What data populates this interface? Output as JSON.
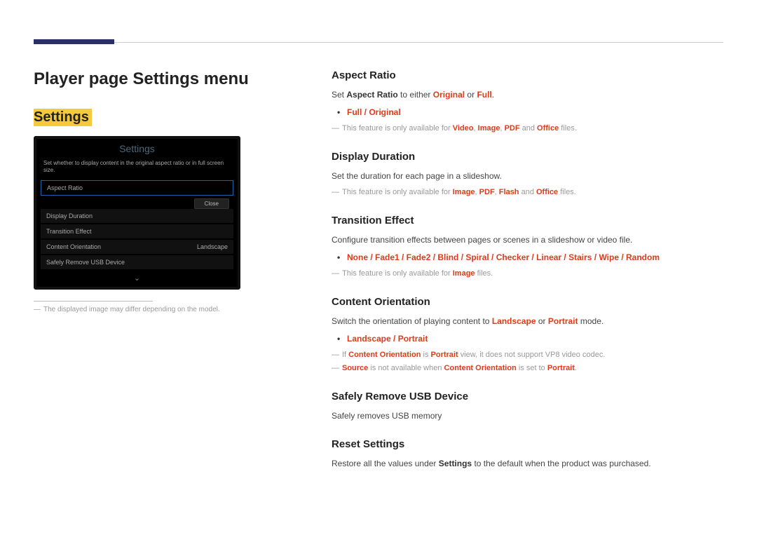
{
  "page_title": "Player page Settings menu",
  "left": {
    "highlight": "Settings",
    "img_note": "The displayed image may differ depending on the model."
  },
  "device": {
    "title": "Settings",
    "desc": "Set whether to display content in the original aspect ratio or in full screen size.",
    "rows": {
      "r0": "Aspect Ratio",
      "r1": "Display Duration",
      "r2": "Transition Effect",
      "r3": "Content Orientation",
      "r3v": "Landscape",
      "r4": "Safely Remove USB Device"
    },
    "close": "Close"
  },
  "aspect": {
    "head": "Aspect Ratio",
    "p1a": "Set ",
    "p1b": "Aspect Ratio",
    "p1c": " to either ",
    "p1d": "Original",
    "p1e": " or ",
    "p1f": "Full",
    "p1g": ".",
    "opt": "Full / Original",
    "note_a": "This feature is only available for ",
    "note_v": "Video",
    "note_i": "Image",
    "note_p": "PDF",
    "note_o": "Office",
    "note_z": " files.",
    "sep": ", ",
    "and": " and "
  },
  "duration": {
    "head": "Display Duration",
    "p1": "Set the duration for each page in a slideshow.",
    "note_a": "This feature is only available for ",
    "note_i": "Image",
    "note_p": "PDF",
    "note_f": "Flash",
    "note_o": "Office",
    "note_z": " files."
  },
  "transition": {
    "head": "Transition Effect",
    "p1": "Configure transition effects between pages or scenes in a slideshow or video file.",
    "opt": "None / Fade1 / Fade2 / Blind / Spiral / Checker / Linear / Stairs / Wipe / Random",
    "note_a": "This feature is only available for ",
    "note_i": "Image",
    "note_z": " files."
  },
  "orientation": {
    "head": "Content Orientation",
    "p1a": "Switch the orientation of playing content to ",
    "p1b": "Landscape",
    "p1c": " or ",
    "p1d": "Portrait",
    "p1e": " mode.",
    "opt": "Landscape / Portrait",
    "n1a": "If ",
    "n1b": "Content Orientation",
    "n1c": " is ",
    "n1d": "Portrait",
    "n1e": " view, it does not support VP8 video codec.",
    "n2a": "Source",
    "n2b": " is not available when ",
    "n2c": "Content Orientation",
    "n2d": " is set to ",
    "n2e": "Portrait",
    "n2f": "."
  },
  "usb": {
    "head": "Safely Remove USB Device",
    "p1": "Safely removes USB memory"
  },
  "reset": {
    "head": "Reset Settings",
    "p1a": "Restore all the values under ",
    "p1b": "Settings",
    "p1c": " to the default when the product was purchased."
  }
}
